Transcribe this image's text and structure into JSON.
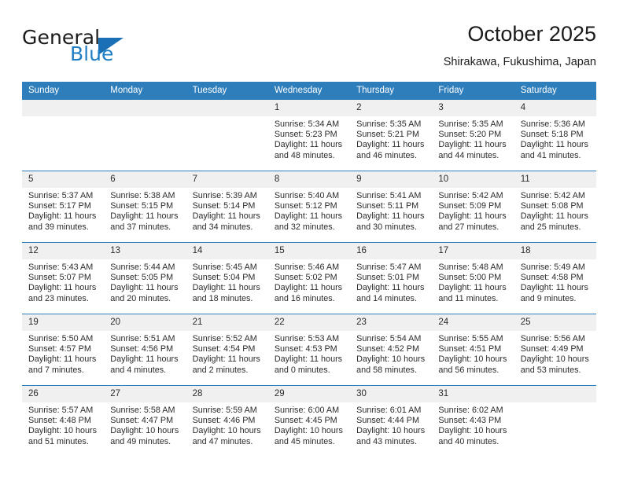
{
  "brand": {
    "name_top": "General",
    "name_bottom": "Blue",
    "accent_color": "#1a6fb5",
    "text_color": "#1b1b1b"
  },
  "header": {
    "title": "October 2025",
    "subtitle": "Shirakawa, Fukushima, Japan"
  },
  "calendar": {
    "header_bg": "#2e7ebc",
    "daynum_bg": "#f0f0f0",
    "weekdays": [
      "Sunday",
      "Monday",
      "Tuesday",
      "Wednesday",
      "Thursday",
      "Friday",
      "Saturday"
    ],
    "weeks": [
      [
        {
          "day": "",
          "sunrise": "",
          "sunset": "",
          "daylight_line1": "",
          "daylight_line2": "",
          "empty": true
        },
        {
          "day": "",
          "sunrise": "",
          "sunset": "",
          "daylight_line1": "",
          "daylight_line2": "",
          "empty": true
        },
        {
          "day": "",
          "sunrise": "",
          "sunset": "",
          "daylight_line1": "",
          "daylight_line2": "",
          "empty": true
        },
        {
          "day": "1",
          "sunrise": "Sunrise: 5:34 AM",
          "sunset": "Sunset: 5:23 PM",
          "daylight_line1": "Daylight: 11 hours",
          "daylight_line2": "and 48 minutes.",
          "empty": false
        },
        {
          "day": "2",
          "sunrise": "Sunrise: 5:35 AM",
          "sunset": "Sunset: 5:21 PM",
          "daylight_line1": "Daylight: 11 hours",
          "daylight_line2": "and 46 minutes.",
          "empty": false
        },
        {
          "day": "3",
          "sunrise": "Sunrise: 5:35 AM",
          "sunset": "Sunset: 5:20 PM",
          "daylight_line1": "Daylight: 11 hours",
          "daylight_line2": "and 44 minutes.",
          "empty": false
        },
        {
          "day": "4",
          "sunrise": "Sunrise: 5:36 AM",
          "sunset": "Sunset: 5:18 PM",
          "daylight_line1": "Daylight: 11 hours",
          "daylight_line2": "and 41 minutes.",
          "empty": false
        }
      ],
      [
        {
          "day": "5",
          "sunrise": "Sunrise: 5:37 AM",
          "sunset": "Sunset: 5:17 PM",
          "daylight_line1": "Daylight: 11 hours",
          "daylight_line2": "and 39 minutes.",
          "empty": false
        },
        {
          "day": "6",
          "sunrise": "Sunrise: 5:38 AM",
          "sunset": "Sunset: 5:15 PM",
          "daylight_line1": "Daylight: 11 hours",
          "daylight_line2": "and 37 minutes.",
          "empty": false
        },
        {
          "day": "7",
          "sunrise": "Sunrise: 5:39 AM",
          "sunset": "Sunset: 5:14 PM",
          "daylight_line1": "Daylight: 11 hours",
          "daylight_line2": "and 34 minutes.",
          "empty": false
        },
        {
          "day": "8",
          "sunrise": "Sunrise: 5:40 AM",
          "sunset": "Sunset: 5:12 PM",
          "daylight_line1": "Daylight: 11 hours",
          "daylight_line2": "and 32 minutes.",
          "empty": false
        },
        {
          "day": "9",
          "sunrise": "Sunrise: 5:41 AM",
          "sunset": "Sunset: 5:11 PM",
          "daylight_line1": "Daylight: 11 hours",
          "daylight_line2": "and 30 minutes.",
          "empty": false
        },
        {
          "day": "10",
          "sunrise": "Sunrise: 5:42 AM",
          "sunset": "Sunset: 5:09 PM",
          "daylight_line1": "Daylight: 11 hours",
          "daylight_line2": "and 27 minutes.",
          "empty": false
        },
        {
          "day": "11",
          "sunrise": "Sunrise: 5:42 AM",
          "sunset": "Sunset: 5:08 PM",
          "daylight_line1": "Daylight: 11 hours",
          "daylight_line2": "and 25 minutes.",
          "empty": false
        }
      ],
      [
        {
          "day": "12",
          "sunrise": "Sunrise: 5:43 AM",
          "sunset": "Sunset: 5:07 PM",
          "daylight_line1": "Daylight: 11 hours",
          "daylight_line2": "and 23 minutes.",
          "empty": false
        },
        {
          "day": "13",
          "sunrise": "Sunrise: 5:44 AM",
          "sunset": "Sunset: 5:05 PM",
          "daylight_line1": "Daylight: 11 hours",
          "daylight_line2": "and 20 minutes.",
          "empty": false
        },
        {
          "day": "14",
          "sunrise": "Sunrise: 5:45 AM",
          "sunset": "Sunset: 5:04 PM",
          "daylight_line1": "Daylight: 11 hours",
          "daylight_line2": "and 18 minutes.",
          "empty": false
        },
        {
          "day": "15",
          "sunrise": "Sunrise: 5:46 AM",
          "sunset": "Sunset: 5:02 PM",
          "daylight_line1": "Daylight: 11 hours",
          "daylight_line2": "and 16 minutes.",
          "empty": false
        },
        {
          "day": "16",
          "sunrise": "Sunrise: 5:47 AM",
          "sunset": "Sunset: 5:01 PM",
          "daylight_line1": "Daylight: 11 hours",
          "daylight_line2": "and 14 minutes.",
          "empty": false
        },
        {
          "day": "17",
          "sunrise": "Sunrise: 5:48 AM",
          "sunset": "Sunset: 5:00 PM",
          "daylight_line1": "Daylight: 11 hours",
          "daylight_line2": "and 11 minutes.",
          "empty": false
        },
        {
          "day": "18",
          "sunrise": "Sunrise: 5:49 AM",
          "sunset": "Sunset: 4:58 PM",
          "daylight_line1": "Daylight: 11 hours",
          "daylight_line2": "and 9 minutes.",
          "empty": false
        }
      ],
      [
        {
          "day": "19",
          "sunrise": "Sunrise: 5:50 AM",
          "sunset": "Sunset: 4:57 PM",
          "daylight_line1": "Daylight: 11 hours",
          "daylight_line2": "and 7 minutes.",
          "empty": false
        },
        {
          "day": "20",
          "sunrise": "Sunrise: 5:51 AM",
          "sunset": "Sunset: 4:56 PM",
          "daylight_line1": "Daylight: 11 hours",
          "daylight_line2": "and 4 minutes.",
          "empty": false
        },
        {
          "day": "21",
          "sunrise": "Sunrise: 5:52 AM",
          "sunset": "Sunset: 4:54 PM",
          "daylight_line1": "Daylight: 11 hours",
          "daylight_line2": "and 2 minutes.",
          "empty": false
        },
        {
          "day": "22",
          "sunrise": "Sunrise: 5:53 AM",
          "sunset": "Sunset: 4:53 PM",
          "daylight_line1": "Daylight: 11 hours",
          "daylight_line2": "and 0 minutes.",
          "empty": false
        },
        {
          "day": "23",
          "sunrise": "Sunrise: 5:54 AM",
          "sunset": "Sunset: 4:52 PM",
          "daylight_line1": "Daylight: 10 hours",
          "daylight_line2": "and 58 minutes.",
          "empty": false
        },
        {
          "day": "24",
          "sunrise": "Sunrise: 5:55 AM",
          "sunset": "Sunset: 4:51 PM",
          "daylight_line1": "Daylight: 10 hours",
          "daylight_line2": "and 56 minutes.",
          "empty": false
        },
        {
          "day": "25",
          "sunrise": "Sunrise: 5:56 AM",
          "sunset": "Sunset: 4:49 PM",
          "daylight_line1": "Daylight: 10 hours",
          "daylight_line2": "and 53 minutes.",
          "empty": false
        }
      ],
      [
        {
          "day": "26",
          "sunrise": "Sunrise: 5:57 AM",
          "sunset": "Sunset: 4:48 PM",
          "daylight_line1": "Daylight: 10 hours",
          "daylight_line2": "and 51 minutes.",
          "empty": false
        },
        {
          "day": "27",
          "sunrise": "Sunrise: 5:58 AM",
          "sunset": "Sunset: 4:47 PM",
          "daylight_line1": "Daylight: 10 hours",
          "daylight_line2": "and 49 minutes.",
          "empty": false
        },
        {
          "day": "28",
          "sunrise": "Sunrise: 5:59 AM",
          "sunset": "Sunset: 4:46 PM",
          "daylight_line1": "Daylight: 10 hours",
          "daylight_line2": "and 47 minutes.",
          "empty": false
        },
        {
          "day": "29",
          "sunrise": "Sunrise: 6:00 AM",
          "sunset": "Sunset: 4:45 PM",
          "daylight_line1": "Daylight: 10 hours",
          "daylight_line2": "and 45 minutes.",
          "empty": false
        },
        {
          "day": "30",
          "sunrise": "Sunrise: 6:01 AM",
          "sunset": "Sunset: 4:44 PM",
          "daylight_line1": "Daylight: 10 hours",
          "daylight_line2": "and 43 minutes.",
          "empty": false
        },
        {
          "day": "31",
          "sunrise": "Sunrise: 6:02 AM",
          "sunset": "Sunset: 4:43 PM",
          "daylight_line1": "Daylight: 10 hours",
          "daylight_line2": "and 40 minutes.",
          "empty": false
        },
        {
          "day": "",
          "sunrise": "",
          "sunset": "",
          "daylight_line1": "",
          "daylight_line2": "",
          "empty": true
        }
      ]
    ]
  }
}
